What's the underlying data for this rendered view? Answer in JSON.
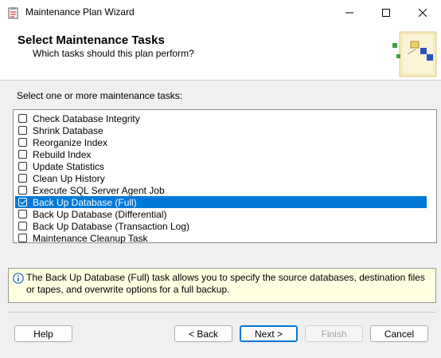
{
  "window": {
    "title": "Maintenance Plan Wizard"
  },
  "header": {
    "title": "Select Maintenance Tasks",
    "subtitle": "Which tasks should this plan perform?"
  },
  "prompt": "Select one or more maintenance tasks:",
  "tasks": [
    {
      "label": "Check Database Integrity",
      "checked": false,
      "selected": false
    },
    {
      "label": "Shrink Database",
      "checked": false,
      "selected": false
    },
    {
      "label": "Reorganize Index",
      "checked": false,
      "selected": false
    },
    {
      "label": "Rebuild Index",
      "checked": false,
      "selected": false
    },
    {
      "label": "Update Statistics",
      "checked": false,
      "selected": false
    },
    {
      "label": "Clean Up History",
      "checked": false,
      "selected": false
    },
    {
      "label": "Execute SQL Server Agent Job",
      "checked": false,
      "selected": false
    },
    {
      "label": "Back Up Database (Full)",
      "checked": true,
      "selected": true
    },
    {
      "label": "Back Up Database (Differential)",
      "checked": false,
      "selected": false
    },
    {
      "label": "Back Up Database (Transaction Log)",
      "checked": false,
      "selected": false
    },
    {
      "label": "Maintenance Cleanup Task",
      "checked": false,
      "selected": false
    }
  ],
  "info": {
    "icon": "info-icon",
    "text": "The Back Up Database (Full) task allows you to specify the source databases, destination files or tapes, and overwrite options for a full backup."
  },
  "buttons": {
    "help": "Help",
    "back": "< Back",
    "next": "Next >",
    "finish": "Finish",
    "cancel": "Cancel"
  },
  "colors": {
    "selection": "#0078d7",
    "info_bg": "#ffffe1"
  }
}
